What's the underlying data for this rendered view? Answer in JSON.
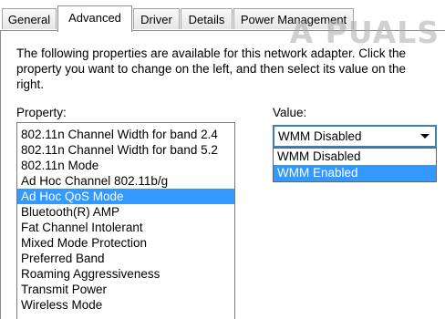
{
  "tabs": [
    {
      "label": "General"
    },
    {
      "label": "Advanced",
      "active": true
    },
    {
      "label": "Driver"
    },
    {
      "label": "Details"
    },
    {
      "label": "Power Management"
    }
  ],
  "watermark": {
    "text": "A PUALS"
  },
  "description": "The following properties are available for this network adapter. Click the property you want to change on the left, and then select its value on the right.",
  "property": {
    "label": "Property:",
    "items": [
      "802.11n Channel Width for band 2.4",
      "802.11n Channel Width for band 5.2",
      "802.11n Mode",
      "Ad Hoc Channel 802.11b/g",
      "Ad Hoc QoS Mode",
      "Bluetooth(R) AMP",
      "Fat Channel Intolerant",
      "Mixed Mode Protection",
      "Preferred Band",
      "Roaming Aggressiveness",
      "Transmit Power",
      "Wireless Mode"
    ],
    "selected": "Ad Hoc QoS Mode"
  },
  "value": {
    "label": "Value:",
    "current": "WMM Disabled",
    "options": [
      "WMM Disabled",
      "WMM Enabled"
    ],
    "highlighted": "WMM Enabled"
  },
  "colors": {
    "selection": "#3399ff",
    "combo_border": "#3c7fb1"
  }
}
